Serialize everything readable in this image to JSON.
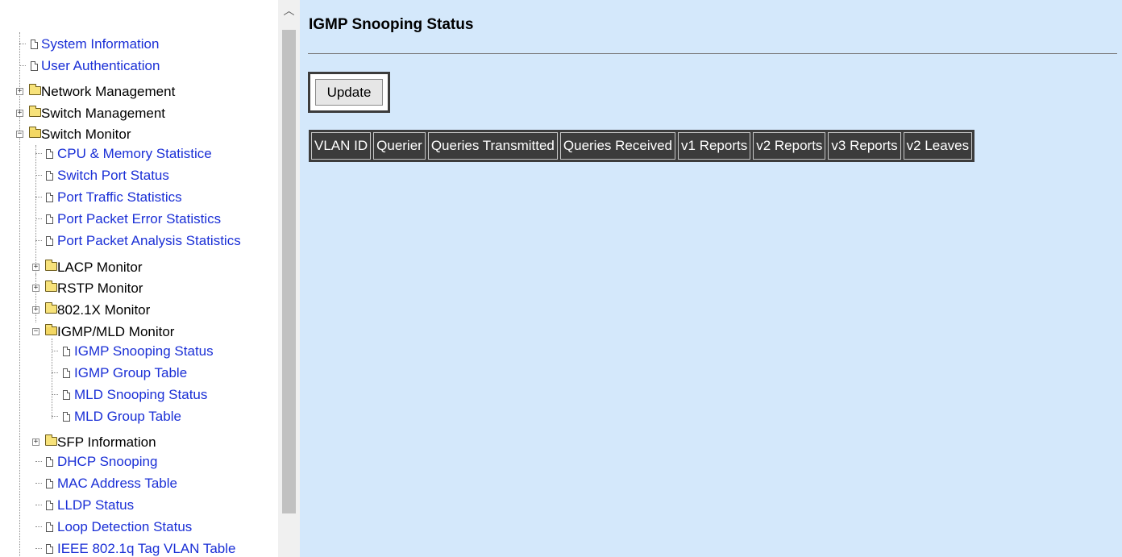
{
  "nav": {
    "items": [
      {
        "label": "System Information",
        "type": "page"
      },
      {
        "label": "User Authentication",
        "type": "page"
      },
      {
        "label": "Network Management",
        "type": "folder"
      },
      {
        "label": "Switch Management",
        "type": "folder"
      },
      {
        "label": "Switch Monitor",
        "type": "folder",
        "open": true
      },
      {
        "label": "CPU & Memory Statistice",
        "type": "page"
      },
      {
        "label": "Switch Port Status",
        "type": "page"
      },
      {
        "label": "Port Traffic Statistics",
        "type": "page"
      },
      {
        "label": "Port Packet Error Statistics",
        "type": "page"
      },
      {
        "label": "Port Packet Analysis Statistics",
        "type": "page"
      },
      {
        "label": "LACP Monitor",
        "type": "folder"
      },
      {
        "label": "RSTP Monitor",
        "type": "folder"
      },
      {
        "label": "802.1X Monitor",
        "type": "folder"
      },
      {
        "label": "IGMP/MLD Monitor",
        "type": "folder",
        "open": true
      },
      {
        "label": "IGMP Snooping Status",
        "type": "page"
      },
      {
        "label": "IGMP Group Table",
        "type": "page"
      },
      {
        "label": "MLD Snooping Status",
        "type": "page"
      },
      {
        "label": "MLD Group Table",
        "type": "page"
      },
      {
        "label": "SFP Information",
        "type": "folder"
      },
      {
        "label": "DHCP Snooping",
        "type": "page"
      },
      {
        "label": "MAC Address Table",
        "type": "page"
      },
      {
        "label": "LLDP Status",
        "type": "page"
      },
      {
        "label": "Loop Detection Status",
        "type": "page"
      },
      {
        "label": "IEEE 802.1q Tag VLAN Table",
        "type": "page"
      }
    ]
  },
  "content": {
    "title": "IGMP Snooping Status",
    "update_label": "Update",
    "table_headers": [
      "VLAN ID",
      "Querier",
      "Queries Transmitted",
      "Queries Received",
      "v1 Reports",
      "v2 Reports",
      "v3 Reports",
      "v2 Leaves"
    ]
  },
  "colors": {
    "content_bg": "#d4e8fb",
    "link": "#1a2fd6",
    "table_header_bg": "#3c3c3c"
  }
}
